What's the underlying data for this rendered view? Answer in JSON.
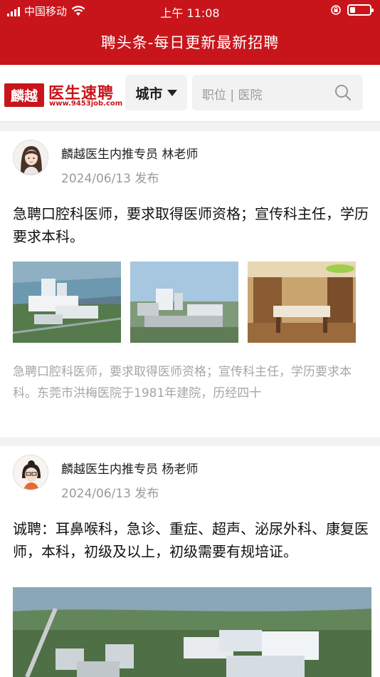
{
  "status_bar": {
    "carrier": "中国移动",
    "time": "上午 11:08",
    "battery_level": 0.25
  },
  "app": {
    "title": "聘头条-每日更新最新招聘"
  },
  "header": {
    "logo_badge": "麟越",
    "logo_name": "医生速聘",
    "logo_url": "www.9453job.com",
    "city_label": "城市",
    "search_placeholder": "职位 | 医院"
  },
  "posts": [
    {
      "author": "麟越医生内推专员  林老师",
      "date": "2024/06/13 发布",
      "body": "急聘口腔科医师，要求取得医师资格；宣传科主任，学历要求本科。",
      "summary": "急聘口腔科医师，要求取得医师资格；宣传科主任，学历要求本科。东莞市洪梅医院于1981年建院，历经四十"
    },
    {
      "author": "麟越医生内推专员  杨老师",
      "date": "2024/06/13 发布",
      "body": "诚聘：耳鼻喉科，急诊、重症、超声、泌尿外科、康复医师，本科，初级及以上，初级需要有规培证。"
    }
  ],
  "colors": {
    "brand_red": "#c8151b",
    "muted_text": "#9a9a9a"
  }
}
